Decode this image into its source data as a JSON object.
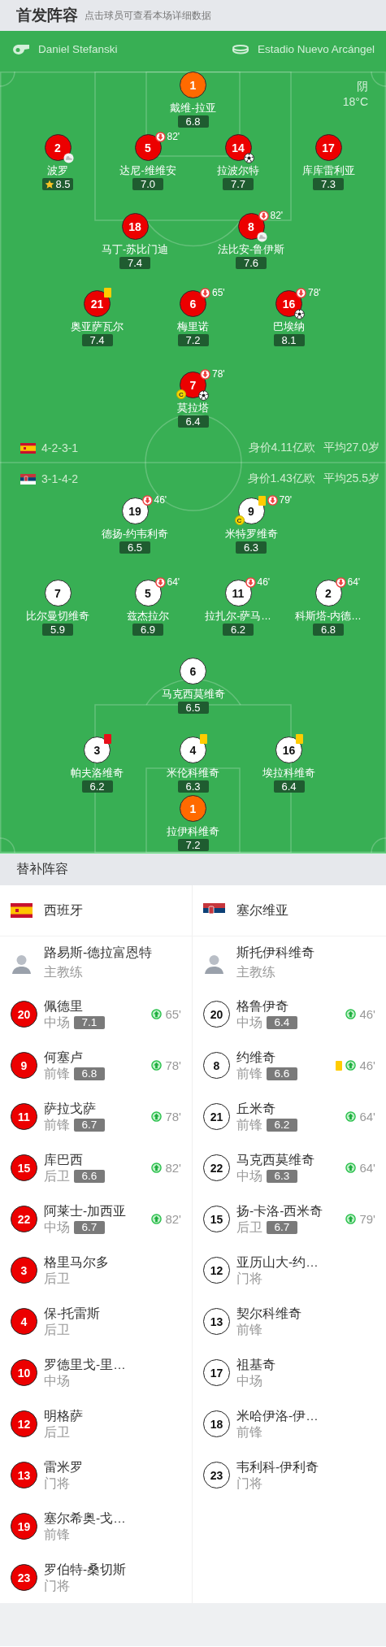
{
  "header": {
    "title": "首发阵容",
    "hint": "点击球员可查看本场详细数据"
  },
  "pitch": {
    "referee": "Daniel Stefanski",
    "stadium": "Estadio Nuevo Arcángel",
    "weather": "阴",
    "temperature": "18°C",
    "home": {
      "kind": "home",
      "formation": "4-2-3-1",
      "market_value": "身价4.11亿欧",
      "average_age": "平均27.0岁",
      "rows": [
        [
          {
            "number": "1",
            "name": "戴维-拉亚",
            "rating": "6.8",
            "kind": "goalkeeper"
          }
        ],
        [
          {
            "number": "2",
            "name": "波罗",
            "rating": "8.5",
            "kind": "outfield",
            "events": [
              {
                "kind": "assist"
              },
              {
                "kind": "top_rated"
              }
            ]
          },
          {
            "number": "5",
            "name": "达尼-维维安",
            "rating": "7.0",
            "kind": "outfield",
            "sub_off": "82'"
          },
          {
            "number": "14",
            "name": "拉波尔特",
            "rating": "7.7",
            "kind": "outfield",
            "events": [
              {
                "kind": "goal"
              }
            ]
          },
          {
            "number": "17",
            "name": "库库雷利亚",
            "rating": "7.3",
            "kind": "outfield"
          }
        ],
        [
          {
            "number": "18",
            "name": "马丁-苏比门迪",
            "rating": "7.4",
            "kind": "outfield"
          },
          {
            "number": "8",
            "name": "法比安-鲁伊斯",
            "rating": "7.6",
            "kind": "outfield",
            "sub_off": "82'",
            "events": [
              {
                "kind": "assist"
              }
            ]
          }
        ],
        [
          {
            "number": "21",
            "name": "奥亚萨瓦尔",
            "rating": "7.4",
            "kind": "outfield",
            "events": [
              {
                "kind": "yellow_card"
              }
            ]
          },
          {
            "number": "6",
            "name": "梅里诺",
            "rating": "7.2",
            "kind": "outfield",
            "sub_off": "65'"
          },
          {
            "number": "16",
            "name": "巴埃纳",
            "rating": "8.1",
            "kind": "outfield",
            "sub_off": "78'",
            "events": [
              {
                "kind": "goal"
              }
            ]
          }
        ],
        [
          {
            "number": "7",
            "name": "莫拉塔",
            "rating": "6.4",
            "kind": "outfield",
            "sub_off": "78'",
            "events": [
              {
                "kind": "captain",
                "label": "C"
              },
              {
                "kind": "goal"
              }
            ]
          }
        ]
      ]
    },
    "away": {
      "kind": "away",
      "formation": "3-1-4-2",
      "market_value": "身价1.43亿欧",
      "average_age": "平均25.5岁",
      "rows": [
        [
          {
            "number": "19",
            "name": "德扬-约韦利奇",
            "rating": "6.5",
            "kind": "outfield",
            "sub_off": "46'"
          },
          {
            "number": "9",
            "name": "米特罗维奇",
            "rating": "6.3",
            "kind": "outfield",
            "sub_off": "79'",
            "events": [
              {
                "kind": "yellow_card"
              },
              {
                "kind": "captain",
                "label": "C"
              }
            ]
          }
        ],
        [
          {
            "number": "7",
            "name": "比尔曼切维奇",
            "rating": "5.9",
            "kind": "outfield"
          },
          {
            "number": "5",
            "name": "兹杰拉尔",
            "rating": "6.9",
            "kind": "outfield",
            "sub_off": "64'"
          },
          {
            "number": "11",
            "name": "拉扎尔-萨马…",
            "rating": "6.2",
            "kind": "outfield",
            "sub_off": "46'"
          },
          {
            "number": "2",
            "name": "科斯塔-内德…",
            "rating": "6.8",
            "kind": "outfield",
            "sub_off": "64'"
          }
        ],
        [
          {
            "number": "6",
            "name": "马克西莫维奇",
            "rating": "6.5",
            "kind": "outfield"
          }
        ],
        [
          {
            "number": "3",
            "name": "帕夫洛维奇",
            "rating": "6.2",
            "kind": "outfield",
            "events": [
              {
                "kind": "red_card"
              }
            ]
          },
          {
            "number": "4",
            "name": "米伦科维奇",
            "rating": "6.3",
            "kind": "outfield",
            "events": [
              {
                "kind": "yellow_card"
              }
            ]
          },
          {
            "number": "16",
            "name": "埃拉科维奇",
            "rating": "6.4",
            "kind": "outfield",
            "events": [
              {
                "kind": "yellow_card"
              }
            ]
          }
        ],
        [
          {
            "number": "1",
            "name": "拉伊科维奇",
            "rating": "7.2",
            "kind": "goalkeeper"
          }
        ]
      ]
    }
  },
  "substitutes": {
    "title": "替补阵容",
    "teams": [
      {
        "kind": "home",
        "name": "西班牙",
        "coach": {
          "name": "路易斯-德拉富恩特",
          "role": "主教练"
        },
        "players": [
          {
            "number": "20",
            "name": "佩德里",
            "position": "中场",
            "rating": "7.1",
            "sub_on": "65'"
          },
          {
            "number": "9",
            "name": "何塞卢",
            "position": "前锋",
            "rating": "6.8",
            "sub_on": "78'"
          },
          {
            "number": "11",
            "name": "萨拉戈萨",
            "position": "前锋",
            "rating": "6.7",
            "sub_on": "78'"
          },
          {
            "number": "15",
            "name": "库巴西",
            "position": "后卫",
            "rating": "6.6",
            "sub_on": "82'"
          },
          {
            "number": "22",
            "name": "阿莱士-加西亚",
            "position": "中场",
            "rating": "6.7",
            "sub_on": "82'"
          },
          {
            "number": "3",
            "name": "格里马尔多",
            "position": "后卫"
          },
          {
            "number": "4",
            "name": "保-托雷斯",
            "position": "后卫"
          },
          {
            "number": "10",
            "name": "罗德里戈-里…",
            "position": "中场"
          },
          {
            "number": "12",
            "name": "明格萨",
            "position": "后卫"
          },
          {
            "number": "13",
            "name": "雷米罗",
            "position": "门将"
          },
          {
            "number": "19",
            "name": "塞尔希奥-戈…",
            "position": "前锋"
          },
          {
            "number": "23",
            "name": "罗伯特-桑切斯",
            "position": "门将"
          }
        ]
      },
      {
        "kind": "away",
        "name": "塞尔维亚",
        "coach": {
          "name": "斯托伊科维奇",
          "role": "主教练"
        },
        "players": [
          {
            "number": "20",
            "name": "格鲁伊奇",
            "position": "中场",
            "rating": "6.4",
            "sub_on": "46'"
          },
          {
            "number": "8",
            "name": "约维奇",
            "position": "前锋",
            "rating": "6.6",
            "sub_on": "46'",
            "events": [
              {
                "kind": "yellow_card"
              }
            ]
          },
          {
            "number": "21",
            "name": "丘米奇",
            "position": "前锋",
            "rating": "6.2",
            "sub_on": "64'"
          },
          {
            "number": "22",
            "name": "马克西莫维奇",
            "position": "中场",
            "rating": "6.3",
            "sub_on": "64'"
          },
          {
            "number": "15",
            "name": "扬-卡洛-西米奇",
            "position": "后卫",
            "rating": "6.7",
            "sub_on": "79'"
          },
          {
            "number": "12",
            "name": "亚历山大-约…",
            "position": "门将"
          },
          {
            "number": "13",
            "name": "契尔科维奇",
            "position": "前锋"
          },
          {
            "number": "17",
            "name": "祖基奇",
            "position": "中场"
          },
          {
            "number": "18",
            "name": "米哈伊洛-伊…",
            "position": "前锋"
          },
          {
            "number": "23",
            "name": "韦利科-伊利奇",
            "position": "门将"
          }
        ]
      }
    ]
  }
}
